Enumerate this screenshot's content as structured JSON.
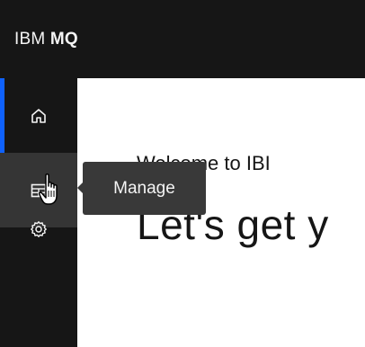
{
  "header": {
    "brand_prefix": "IBM ",
    "brand_product": "MQ"
  },
  "sidenav": {
    "items": [
      {
        "name": "home",
        "icon": "home-icon",
        "active": true
      },
      {
        "name": "manage",
        "icon": "table-icon",
        "hovered": true
      },
      {
        "name": "settings",
        "icon": "gear-icon"
      }
    ],
    "indicator_color": "#0f62fe"
  },
  "tooltip": {
    "text": "Manage"
  },
  "main": {
    "welcome_text": "Welcome to IBI",
    "headline_text": "Let's get y"
  },
  "cursor": {
    "icon": "hand-pointer-icon"
  }
}
